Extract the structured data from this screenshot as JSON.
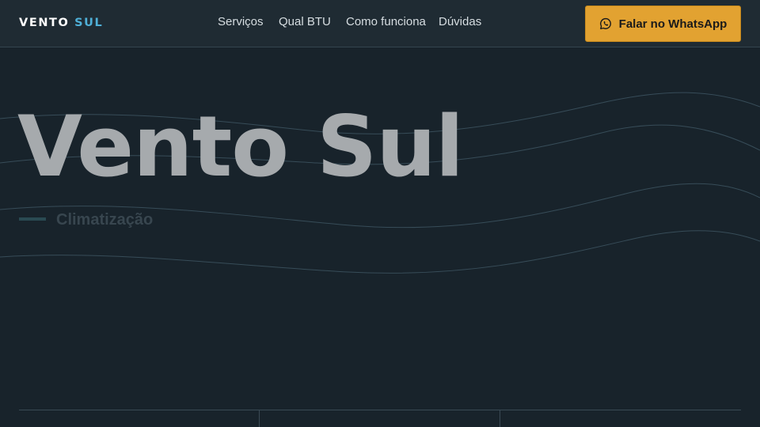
{
  "brand": {
    "logo_primary": "VENTO",
    "logo_accent": "SUL"
  },
  "nav": {
    "items": [
      {
        "label": "Serviços"
      },
      {
        "label": "Qual BTU"
      },
      {
        "label": "Como funciona"
      },
      {
        "label": "Dúvidas"
      }
    ]
  },
  "cta": {
    "label": "Falar no WhatsApp",
    "icon": "whatsapp-icon"
  },
  "hero": {
    "title": "Vento Sul",
    "subtitle": "Climatização"
  },
  "colors": {
    "background": "#18232b",
    "header": "#1f2b33",
    "accent": "#4fb0d8",
    "cta": "#e2a231",
    "title": "#a6aaad"
  }
}
